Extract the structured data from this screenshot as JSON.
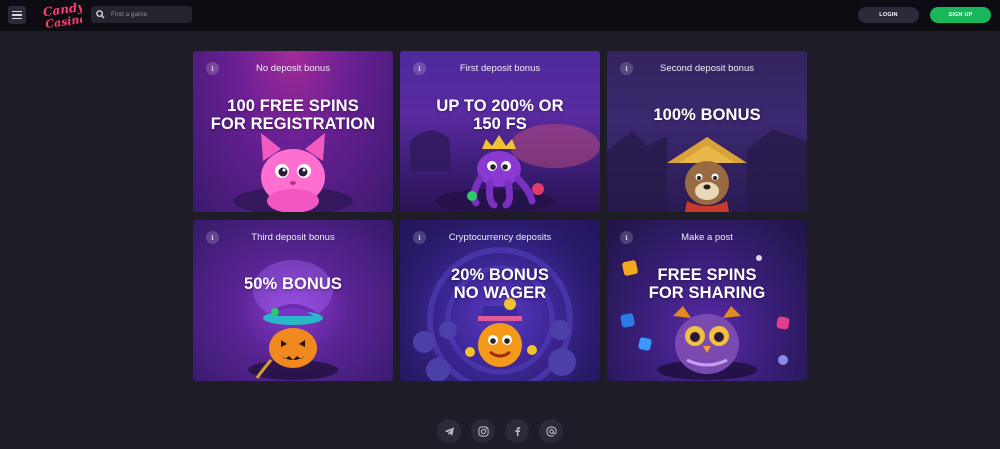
{
  "header": {
    "logo_text": "Candy Casino",
    "search_placeholder": "Find a game",
    "login_label": "LOGIN",
    "signup_label": "SIGN UP"
  },
  "bonuses": [
    {
      "title": "No deposit bonus",
      "headline": [
        "100 FREE SPINS",
        "FOR REGISTRATION"
      ]
    },
    {
      "title": "First deposit bonus",
      "headline": [
        "UP TO 200% OR",
        "150 FS"
      ]
    },
    {
      "title": "Second deposit bonus",
      "headline": [
        "100% BONUS"
      ]
    },
    {
      "title": "Third deposit bonus",
      "headline": [
        "50% BONUS"
      ]
    },
    {
      "title": "Cryptocurrency deposits",
      "headline": [
        "20% BONUS",
        "NO WAGER"
      ]
    },
    {
      "title": "Make a post",
      "headline": [
        "FREE SPINS",
        "FOR SHARING"
      ]
    }
  ],
  "info_icon_glyph": "i",
  "footer": {
    "socials": [
      "telegram-icon",
      "instagram-icon",
      "facebook-icon",
      "email-icon"
    ]
  },
  "colors": {
    "page_bg": "#1d1c27",
    "header_bg": "#0d0c12",
    "signup_green": "#18b85a",
    "login_bg": "#2b2a3a"
  }
}
